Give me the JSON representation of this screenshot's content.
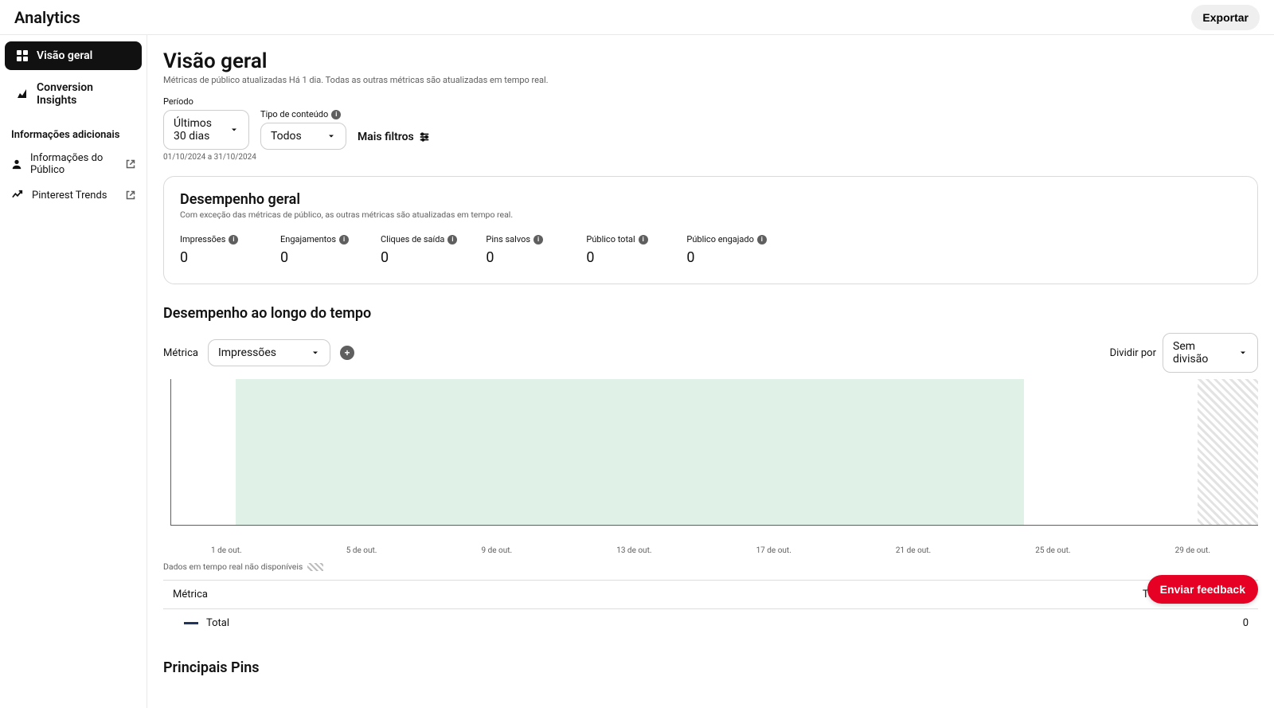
{
  "header": {
    "title": "Analytics",
    "export_label": "Exportar"
  },
  "sidebar": {
    "items": [
      {
        "label": "Visão geral",
        "icon": "dashboard-icon",
        "active": true
      },
      {
        "label": "Conversion Insights",
        "icon": "conversion-icon",
        "active": false
      }
    ],
    "section_title": "Informações adicionais",
    "links": [
      {
        "label": "Informações do Público",
        "icon": "person-icon"
      },
      {
        "label": "Pinterest Trends",
        "icon": "trends-icon"
      }
    ]
  },
  "page": {
    "title": "Visão geral",
    "subtitle": "Métricas de público atualizadas Há 1 dia. Todas as outras métricas são atualizadas em tempo real."
  },
  "filters": {
    "period_label": "Período",
    "period_value": "Últimos 30 dias",
    "date_range": "01/10/2024 a 31/10/2024",
    "content_type_label": "Tipo de conteúdo",
    "content_type_value": "Todos",
    "more_filters": "Mais filtros"
  },
  "performance": {
    "title": "Desempenho geral",
    "subtitle": "Com exceção das métricas de público, as outras métricas são atualizadas em tempo real.",
    "metrics": [
      {
        "label": "Impressões",
        "value": "0"
      },
      {
        "label": "Engajamentos",
        "value": "0"
      },
      {
        "label": "Cliques de saída",
        "value": "0"
      },
      {
        "label": "Pins salvos",
        "value": "0"
      },
      {
        "label": "Público total",
        "value": "0"
      },
      {
        "label": "Público engajado",
        "value": "0"
      }
    ]
  },
  "time_perf": {
    "title": "Desempenho ao longo do tempo",
    "metric_label": "Métrica",
    "metric_value": "Impressões",
    "divide_label": "Dividir por",
    "divide_value": "Sem divisão",
    "xticks": [
      "1 de out.",
      "5 de out.",
      "9 de out.",
      "13 de out.",
      "17 de out.",
      "21 de out.",
      "25 de out.",
      "29 de out."
    ],
    "realtime_note": "Dados em tempo real não disponíveis"
  },
  "chart_data": {
    "type": "line",
    "x": [
      "1 de out.",
      "5 de out.",
      "9 de out.",
      "13 de out.",
      "17 de out.",
      "21 de out.",
      "25 de out.",
      "29 de out."
    ],
    "series": [
      {
        "name": "Total",
        "values": [
          0,
          0,
          0,
          0,
          0,
          0,
          0,
          0
        ]
      }
    ],
    "title": "Desempenho ao longo do tempo",
    "xlabel": "",
    "ylabel": "",
    "ylim": [
      0,
      1
    ]
  },
  "metric_table": {
    "head_left": "Métrica",
    "head_right": "Total de impressões",
    "rows": [
      {
        "label": "Total",
        "value": "0"
      }
    ]
  },
  "bottom": {
    "title": "Principais Pins"
  },
  "feedback": {
    "label": "Enviar feedback"
  }
}
